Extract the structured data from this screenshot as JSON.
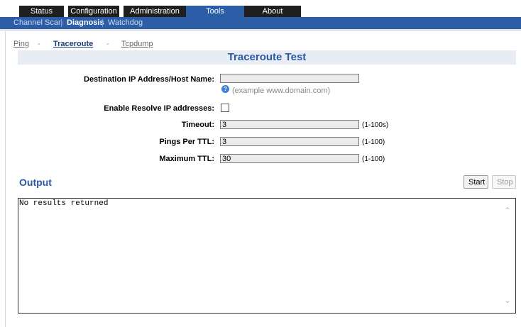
{
  "tabs": [
    {
      "label": "Status",
      "active": false
    },
    {
      "label": "Configuration",
      "active": false
    },
    {
      "label": "Administration",
      "active": false
    },
    {
      "label": "Tools",
      "active": true
    },
    {
      "label": "About",
      "active": false
    }
  ],
  "subnav": [
    {
      "label": "Channel Scan",
      "active": false
    },
    {
      "label": "Diagnosis",
      "active": true
    },
    {
      "label": "Watchdog",
      "active": false
    }
  ],
  "tools": [
    {
      "label": "Ping",
      "active": false
    },
    {
      "label": "Traceroute",
      "active": true
    },
    {
      "label": "Tcpdump",
      "active": false
    }
  ],
  "tool_sep": "-",
  "page_title": "Traceroute Test",
  "form": {
    "dest_label": "Destination IP Address/Host Name:",
    "dest_value": "",
    "dest_example": "(example www.domain.com)",
    "resolve_label": "Enable Resolve IP addresses:",
    "resolve_checked": false,
    "timeout_label": "Timeout:",
    "timeout_value": "3",
    "timeout_hint": "(1-100s)",
    "pings_label": "Pings Per TTL:",
    "pings_value": "3",
    "pings_hint": "(1-100)",
    "maxttl_label": "Maximum TTL:",
    "maxttl_value": "30",
    "maxttl_hint": "(1-100)"
  },
  "output": {
    "title": "Output",
    "start_label": "Start",
    "stop_label": "Stop",
    "text": "No results returned"
  },
  "icons": {
    "help": "help-icon",
    "up": "chevron-up-icon",
    "down": "chevron-down-icon"
  },
  "colors": {
    "nav_blue": "#2c5ea8",
    "tab_dark": "#1f1f1f",
    "title_blue": "#2a58a5"
  }
}
